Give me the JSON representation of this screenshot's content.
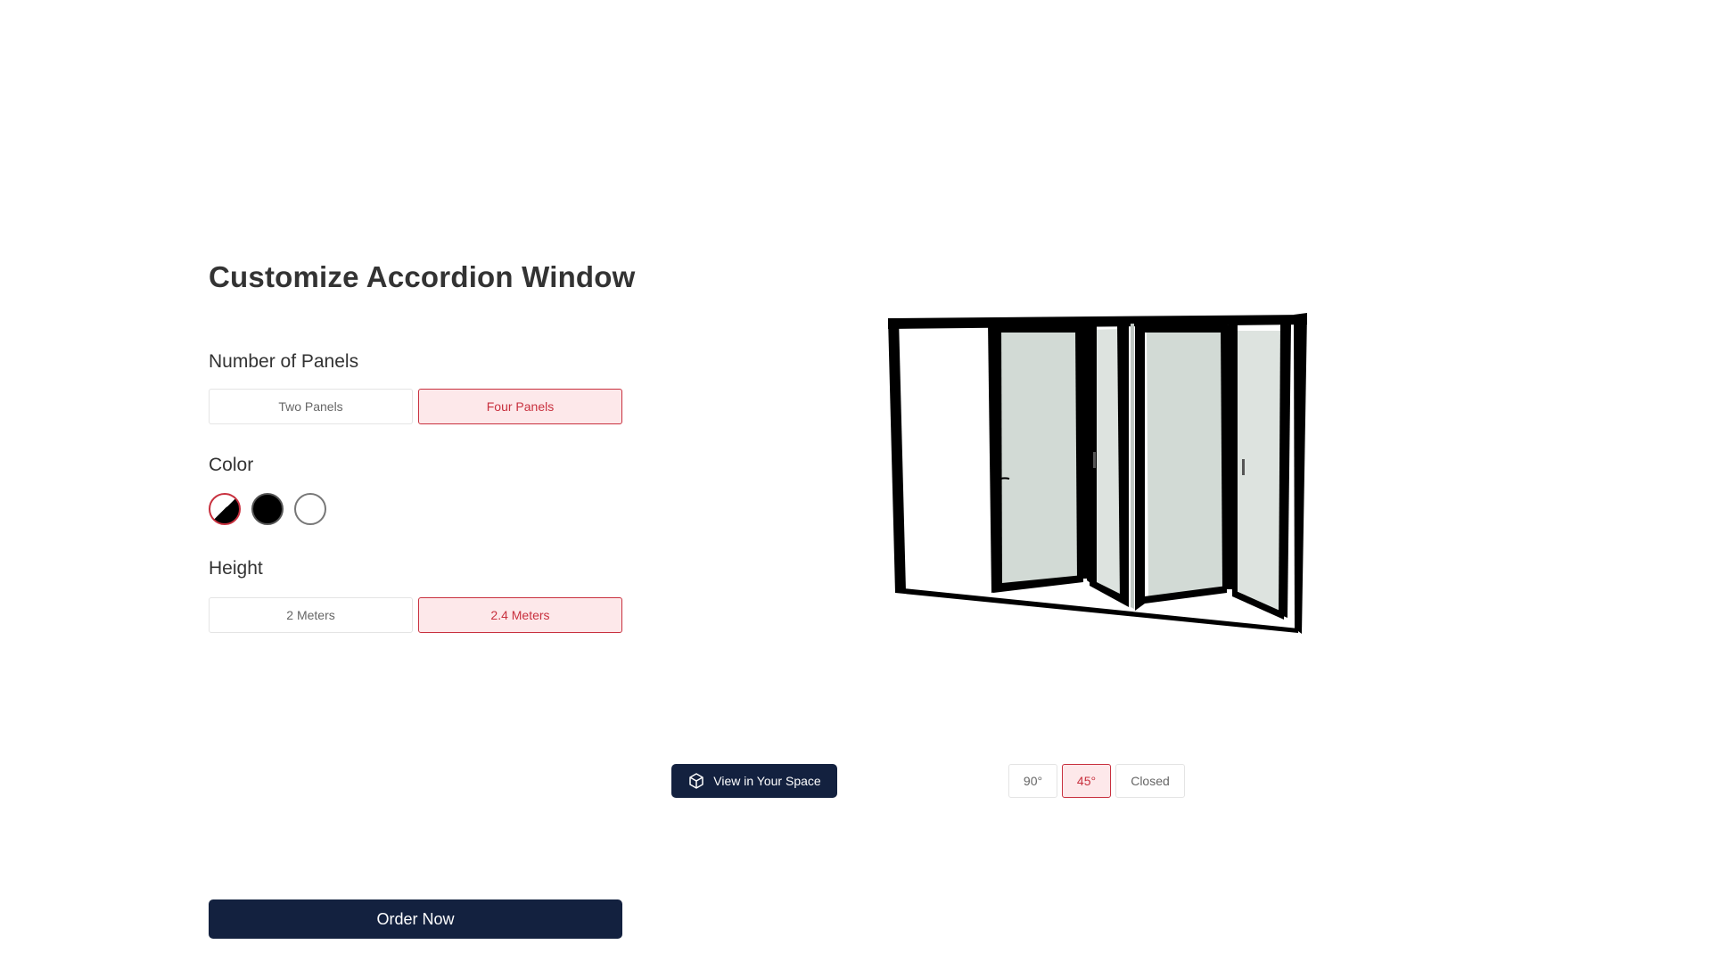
{
  "config": {
    "title": "Customize Accordion Window",
    "panels": {
      "label": "Number of Panels",
      "options": [
        "Two Panels",
        "Four Panels"
      ],
      "selected": "Four Panels"
    },
    "color": {
      "label": "Color",
      "swatches": [
        "black-white-split",
        "black",
        "white"
      ],
      "selected": "black-white-split"
    },
    "height": {
      "label": "Height",
      "options": [
        "2 Meters",
        "2.4 Meters"
      ],
      "selected": "2.4 Meters"
    },
    "order_label": "Order Now"
  },
  "preview": {
    "ar_button_label": "View in Your Space",
    "ar_icon": "cube-3d-icon",
    "angles": [
      "90°",
      "45°",
      "Closed"
    ],
    "selected_angle": "45°"
  },
  "colors": {
    "accent": "#c8303e",
    "accent_bg": "#fde8ea",
    "navy": "#13213f",
    "frame": "#000000",
    "glass": "#d3dbd6"
  }
}
